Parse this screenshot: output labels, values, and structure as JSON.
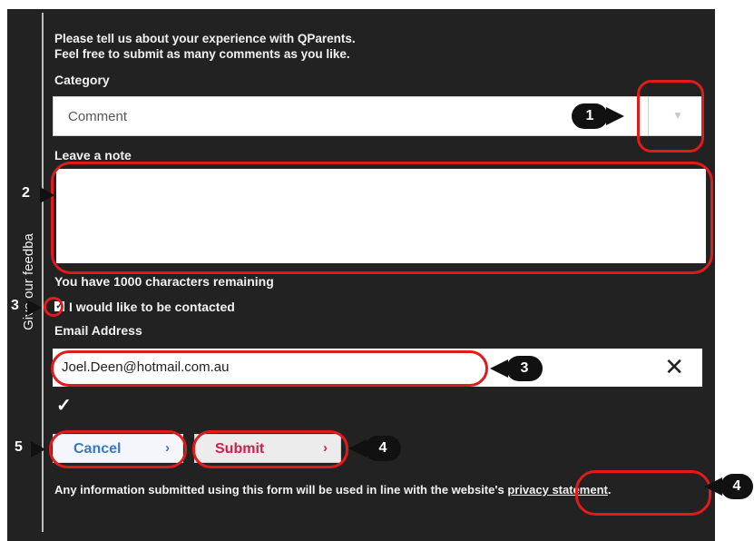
{
  "form": {
    "side_tab_label": "Give our feedba",
    "intro_line1": "Please tell us about your experience with QParents.",
    "intro_line2": "Feel free to submit as many comments as you like.",
    "category_label": "Category",
    "category_value": "Comment",
    "note_label": "Leave a note",
    "note_value": "",
    "chars_remaining": "You have 1000 characters remaining",
    "contact_label": "I would like to be contacted",
    "contact_checked": true,
    "email_label": "Email Address",
    "email_value": "Joel.Deen@hotmail.com.au",
    "clear_glyph": "✕",
    "valid_glyph": "✓",
    "cancel_label": "Cancel",
    "submit_label": "Submit",
    "chevron_glyph": "›",
    "footer_text": "Any information submitted using this form will be used in line with the website's ",
    "privacy_link": "privacy statement",
    "footer_end": "."
  },
  "annotations": {
    "marker_1": "1",
    "marker_2": "2",
    "marker_3_checkbox": "3",
    "marker_3_email": "3",
    "marker_4_submit": "4",
    "marker_4_privacy": "4",
    "marker_5": "5",
    "highlight_color": "#e11b1b"
  },
  "icons": {
    "select_arrow": "chevron-down-icon",
    "clear": "close-icon",
    "valid": "checkmark-icon",
    "button_chevron": "chevron-right-icon"
  }
}
